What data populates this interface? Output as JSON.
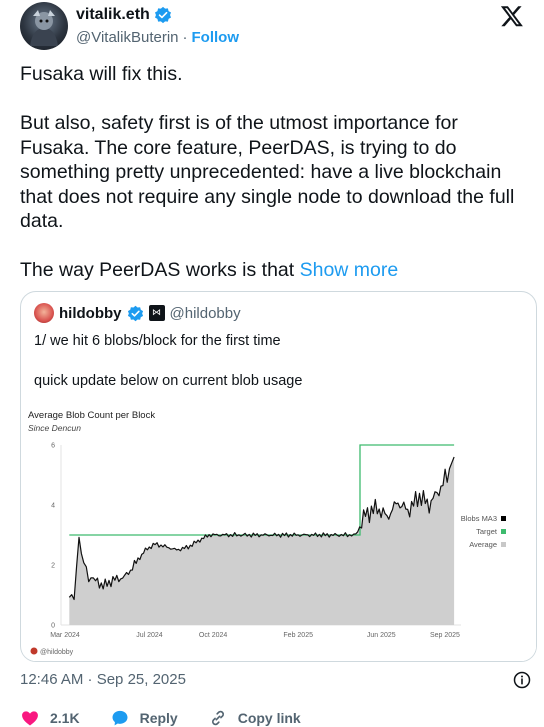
{
  "author": {
    "display_name": "vitalik.eth",
    "handle": "@VitalikButerin",
    "separator": "·",
    "follow_label": "Follow"
  },
  "tweet": {
    "paragraphs": [
      "Fusaka will fix this.",
      "But also, safety first is of the utmost importance for Fusaka. The core feature, PeerDAS, is trying to do something pretty unprecedented: have a live blockchain that does not require any single node to download the full data.",
      "The way PeerDAS works is that "
    ],
    "show_more_label": "Show more"
  },
  "quoted": {
    "name": "hildobby",
    "handle": "@hildobby",
    "badge_glyph": "⋈",
    "line1": "1/ we hit 6 blobs/block for the first time",
    "line2": "quick update below on current blob usage"
  },
  "chart_data": {
    "type": "line",
    "title": "Average Blob Count per Block",
    "subtitle": "Since Dencun",
    "watermark": "@hildobby",
    "x_ticks": [
      "Mar 2024",
      "Jul 2024",
      "Oct 2024",
      "Feb 2025",
      "Jun 2025",
      "Sep 2025"
    ],
    "y_ticks": [
      "0",
      "2",
      "4",
      "6"
    ],
    "ylim": [
      0,
      6
    ],
    "legend_position": "right",
    "series": [
      {
        "name": "Blobs MA3",
        "color": "#000000"
      },
      {
        "name": "Target",
        "color": "#3dbb6e"
      },
      {
        "name": "Average",
        "color": "#c8c8c8"
      }
    ],
    "target": [
      {
        "date": "2024-03-13",
        "value": 3
      },
      {
        "date": "2025-05-07",
        "value": 3
      },
      {
        "date": "2025-05-07",
        "value": 6
      },
      {
        "date": "2025-09-20",
        "value": 6
      }
    ],
    "ma3": [
      {
        "date": "2024-03-13",
        "value": 1.0
      },
      {
        "date": "2024-03-20",
        "value": 0.9
      },
      {
        "date": "2024-03-27",
        "value": 2.9
      },
      {
        "date": "2024-04-03",
        "value": 2.0
      },
      {
        "date": "2024-04-10",
        "value": 1.6
      },
      {
        "date": "2024-04-20",
        "value": 1.5
      },
      {
        "date": "2024-05-01",
        "value": 1.3
      },
      {
        "date": "2024-05-15",
        "value": 1.5
      },
      {
        "date": "2024-06-01",
        "value": 1.6
      },
      {
        "date": "2024-06-15",
        "value": 2.0
      },
      {
        "date": "2024-07-01",
        "value": 2.5
      },
      {
        "date": "2024-07-15",
        "value": 2.7
      },
      {
        "date": "2024-08-01",
        "value": 2.6
      },
      {
        "date": "2024-08-15",
        "value": 2.5
      },
      {
        "date": "2024-09-01",
        "value": 2.6
      },
      {
        "date": "2024-09-15",
        "value": 2.8
      },
      {
        "date": "2024-10-01",
        "value": 3.0
      },
      {
        "date": "2024-11-01",
        "value": 3.0
      },
      {
        "date": "2024-12-01",
        "value": 3.0
      },
      {
        "date": "2025-01-01",
        "value": 3.0
      },
      {
        "date": "2025-02-01",
        "value": 3.0
      },
      {
        "date": "2025-03-01",
        "value": 3.0
      },
      {
        "date": "2025-04-01",
        "value": 3.0
      },
      {
        "date": "2025-05-01",
        "value": 3.0
      },
      {
        "date": "2025-05-15",
        "value": 3.7
      },
      {
        "date": "2025-06-01",
        "value": 3.9
      },
      {
        "date": "2025-06-15",
        "value": 3.6
      },
      {
        "date": "2025-07-01",
        "value": 4.1
      },
      {
        "date": "2025-07-15",
        "value": 3.8
      },
      {
        "date": "2025-08-01",
        "value": 4.3
      },
      {
        "date": "2025-08-15",
        "value": 4.0
      },
      {
        "date": "2025-09-01",
        "value": 4.6
      },
      {
        "date": "2025-09-10",
        "value": 5.0
      },
      {
        "date": "2025-09-20",
        "value": 5.6
      }
    ]
  },
  "meta": {
    "timestamp": "12:46 AM · Sep 25, 2025"
  },
  "actions": {
    "like_count": "2.1K",
    "reply_label": "Reply",
    "copy_label": "Copy link"
  },
  "colors": {
    "accent": "#1d9bf0",
    "like": "#f91880",
    "target": "#3dbb6e",
    "area": "#c8c8c8"
  }
}
